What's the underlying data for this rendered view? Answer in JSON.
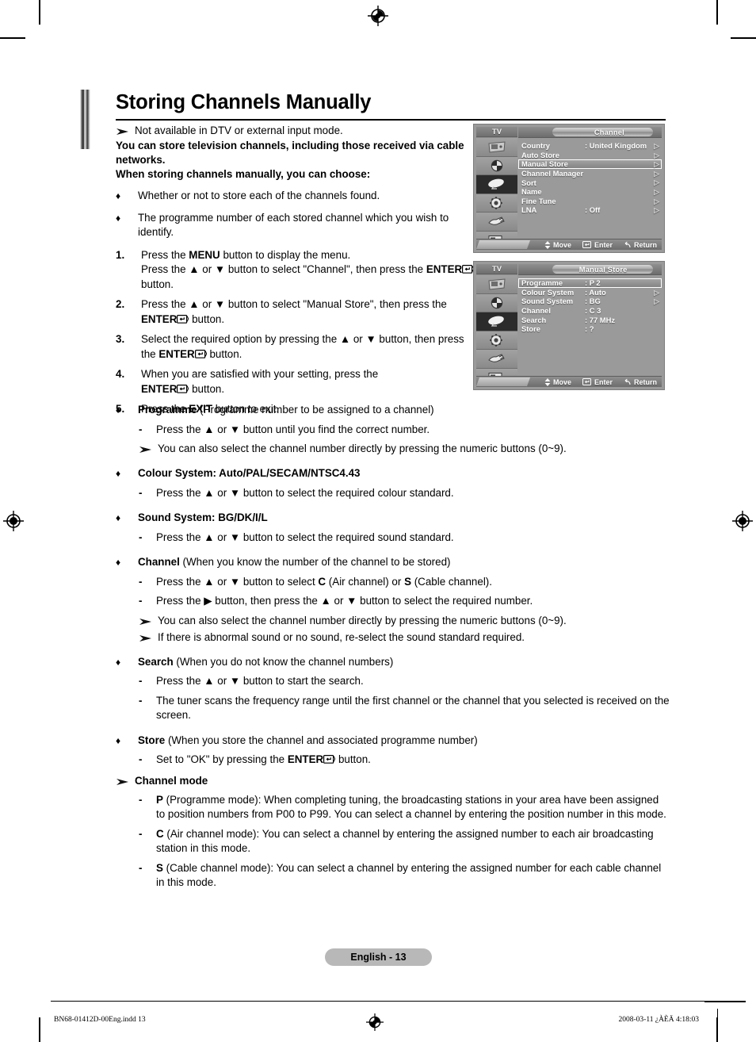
{
  "document": {
    "title": "Storing Channels Manually",
    "page_label": "English - 13",
    "footer_left": "BN68-01412D-00Eng.indd   13",
    "footer_right": "2008-03-11   ¿ÀÈÄ 4:18:03"
  },
  "intro": {
    "note": "Not available in DTV or external input mode.",
    "bold_line_1": "You can store television channels, including those received via cable networks.",
    "bold_line_2": "When storing channels manually, you can choose:",
    "bullets": [
      "Whether or not to store each of the channels found.",
      "The programme number of each stored channel which you wish to identify."
    ],
    "bullet_glyph": "♦"
  },
  "steps": [
    {
      "num": "1.",
      "parts": [
        "Press the ",
        "MENU",
        " button to display the menu.",
        "Press the ▲ or ▼ button to select \"Channel\", then press the ",
        "ENTER",
        " button."
      ]
    },
    {
      "num": "2.",
      "parts": [
        "Press the ▲ or ▼ button to select \"Manual Store\", then press the ",
        "ENTER",
        " button."
      ]
    },
    {
      "num": "3.",
      "parts": [
        "Select the required option by pressing the ▲ or ▼ button, then press the ",
        "ENTER",
        " button."
      ]
    },
    {
      "num": "4.",
      "parts": [
        "When you are satisfied with your setting, press the ",
        "ENTER",
        " button."
      ]
    },
    {
      "num": "5.",
      "parts": [
        "Press the ",
        "EXIT",
        " button to exit."
      ]
    }
  ],
  "step_text": {
    "s1a_pre": "Press the ",
    "s1a_key": "MENU",
    "s1a_post": " button to display the menu.",
    "s1b_pre": "Press the ▲ or ▼ button to select \"Channel\", then press the ",
    "s1b_key": "ENTER",
    "s1b_post": " button.",
    "s2_pre": "Press the ▲ or ▼ button to select \"Manual Store\", then press the ",
    "s2_key": "ENTER",
    "s2_post": " button.",
    "s3_pre": "Select the required option by pressing the ▲ or ▼ button, then press the ",
    "s3_key": "ENTER",
    "s3_post": " button.",
    "s4_pre": "When you are satisfied with your setting, press the ",
    "s4_key": "ENTER",
    "s4_post": " button.",
    "s5_pre": "Press the ",
    "s5_key": "EXIT",
    "s5_post": " button to exit."
  },
  "options": {
    "programme": {
      "heading_bold": "Programme",
      "heading_rest": " (Programme number to be assigned to a channel)",
      "dash_1": "Press the ▲ or ▼ button until you find the correct number.",
      "note_1": "You can also select the channel number directly by pressing the numeric buttons (0~9)."
    },
    "colour_system": {
      "heading_bold": "Colour System: Auto/PAL/SECAM/NTSC4.43",
      "dash_1": "Press the ▲ or ▼ button to select the required colour standard."
    },
    "sound_system": {
      "heading_bold": "Sound System: BG/DK/I/L",
      "dash_1": "Press the ▲ or ▼ button to select the required sound standard."
    },
    "channel": {
      "heading_bold": "Channel",
      "heading_rest": " (When you know the number of the channel to be stored)",
      "dash_1_a": "Press the ▲ or ▼ button to select ",
      "dash_1_c": "C",
      "dash_1_b": " (Air channel) or ",
      "dash_1_s": "S",
      "dash_1_d": " (Cable channel).",
      "dash_2": "Press the ▶ button, then press the ▲ or ▼ button to select the required number.",
      "note_1": "You can also select the channel number directly by pressing the numeric buttons (0~9).",
      "note_2": "If there is abnormal sound or no sound, re-select the sound standard required."
    },
    "search": {
      "heading_bold": "Search",
      "heading_rest": " (When you do not know the channel numbers)",
      "dash_1": "Press the ▲ or ▼ button to start the search.",
      "dash_2": "The tuner scans the frequency range until the first channel or the channel that you selected is received on the screen."
    },
    "store": {
      "heading_bold": "Store",
      "heading_rest": " (When you store the channel and associated programme number)",
      "dash_1_pre": "Set to \"OK\" by pressing the ",
      "dash_1_key": "ENTER",
      "dash_1_post": " button."
    },
    "channel_mode": {
      "note_heading": "Channel mode",
      "p_key": "P",
      "p_text": " (Programme mode): When completing tuning, the broadcasting stations in your area have been assigned to position numbers from P00 to P99. You can select a channel by entering the position number in this mode.",
      "c_key": "C",
      "c_text": " (Air channel mode): You can select a channel by entering the assigned number to each air broadcasting station in this mode.",
      "s_key": "S",
      "s_text": " (Cable channel mode): You can select a channel by entering the assigned number for each cable channel in this mode."
    }
  },
  "osd_channel": {
    "device_label": "TV",
    "title": "Channel",
    "sidebar_icons": [
      "picture-icon",
      "sound-icon",
      "channel-dish-icon",
      "setup-gear-icon",
      "input-plug-icon",
      "pc-setup-icon"
    ],
    "selected_icon_index": 2,
    "rows": [
      {
        "label": "Country",
        "value": ": United Kingdom",
        "arrow": "▷",
        "highlight": false
      },
      {
        "label": "Auto Store",
        "value": "",
        "arrow": "▷",
        "highlight": false
      },
      {
        "label": "Manual Store",
        "value": "",
        "arrow": "▷",
        "highlight": true
      },
      {
        "label": "Channel Manager",
        "value": "",
        "arrow": "▷",
        "highlight": false
      },
      {
        "label": "Sort",
        "value": "",
        "arrow": "▷",
        "highlight": false
      },
      {
        "label": "Name",
        "value": "",
        "arrow": "▷",
        "highlight": false
      },
      {
        "label": "Fine Tune",
        "value": "",
        "arrow": "▷",
        "highlight": false
      },
      {
        "label": "LNA",
        "value": ": Off",
        "arrow": "▷",
        "highlight": false
      }
    ],
    "footer": {
      "move": "Move",
      "enter": "Enter",
      "return": "Return"
    }
  },
  "osd_manual_store": {
    "device_label": "TV",
    "title": "Manual Store",
    "sidebar_icons": [
      "picture-icon",
      "sound-icon",
      "channel-dish-icon",
      "setup-gear-icon",
      "input-plug-icon",
      "pc-setup-icon"
    ],
    "selected_icon_index": 2,
    "rows": [
      {
        "label": "Programme",
        "value": ": P 2",
        "arrow": "",
        "highlight": true
      },
      {
        "label": "Colour System",
        "value": ": Auto",
        "arrow": "▷",
        "highlight": false
      },
      {
        "label": "Sound System",
        "value": ": BG",
        "arrow": "▷",
        "highlight": false
      },
      {
        "label": "Channel",
        "value": ": C 3",
        "arrow": "",
        "highlight": false
      },
      {
        "label": "Search",
        "value": ": 77 MHz",
        "arrow": "",
        "highlight": false
      },
      {
        "label": "Store",
        "value": ": ?",
        "arrow": "",
        "highlight": false
      }
    ],
    "footer": {
      "move": "Move",
      "enter": "Enter",
      "return": "Return"
    }
  }
}
